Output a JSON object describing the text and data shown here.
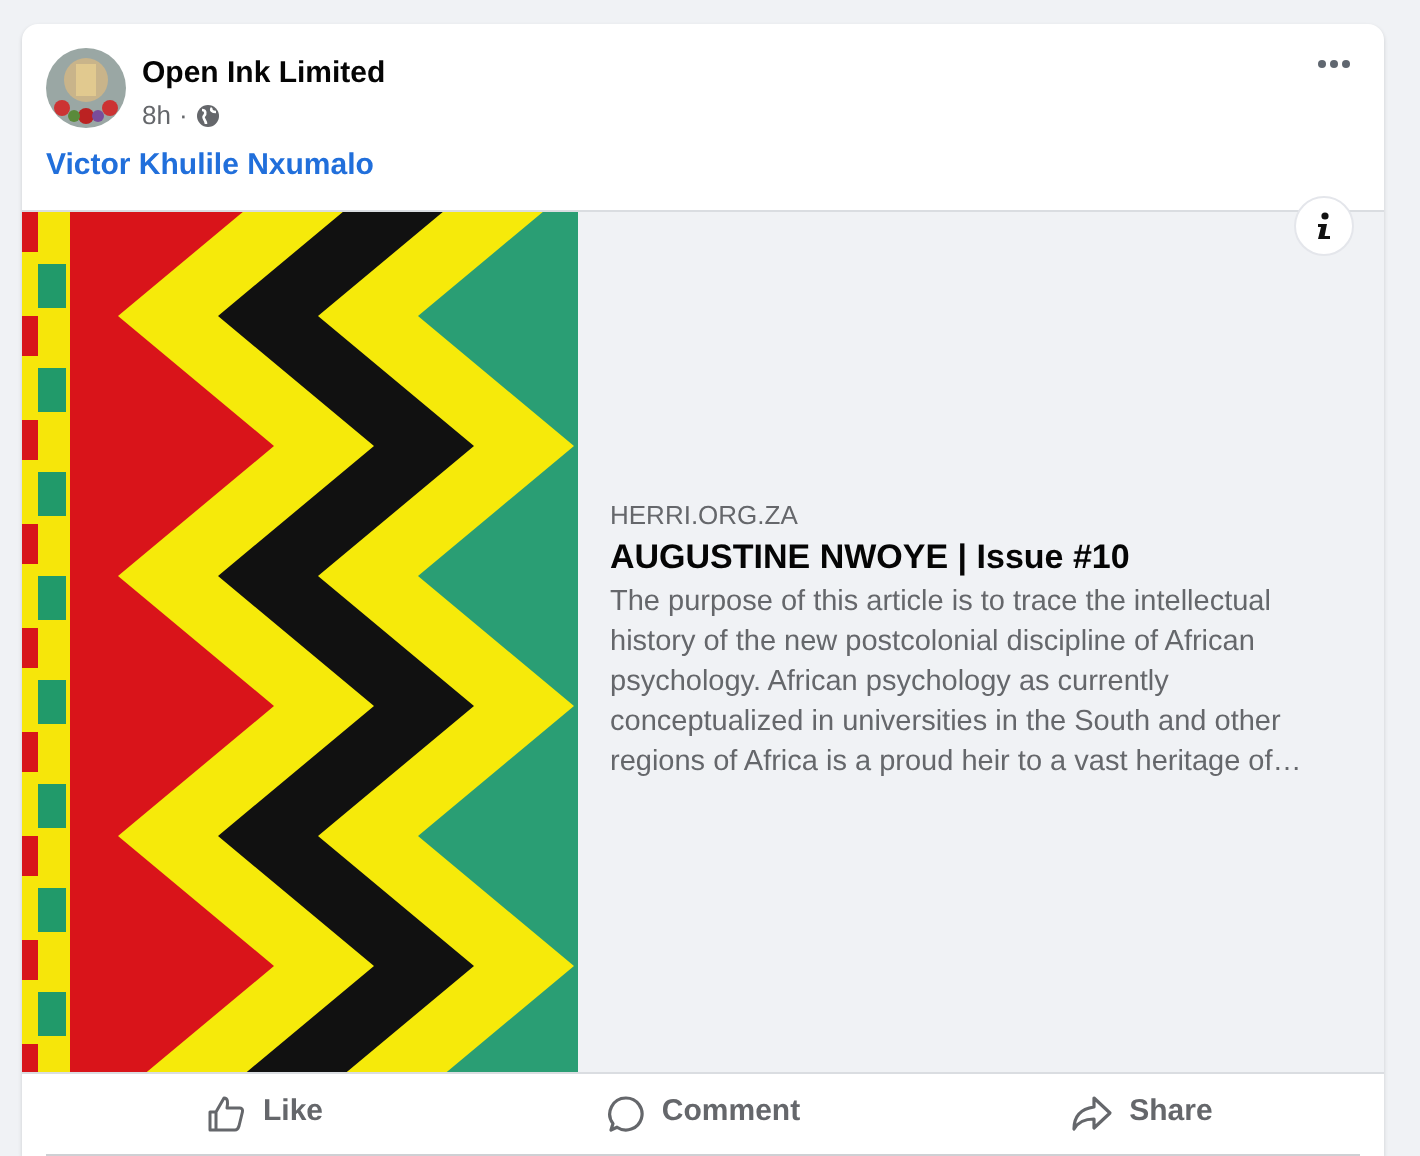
{
  "post": {
    "author": "Open Ink Limited",
    "time": "8h",
    "separator": "·",
    "tagged_link": "Victor Khulile Nxumalo"
  },
  "link_preview": {
    "domain": "HERRI.ORG.ZA",
    "title": "AUGUSTINE NWOYE | Issue #10",
    "description": "The purpose of this article is to trace the intellectual history of the new postcolonial discipline of African psychology. African psychology as currently conceptualized in universities in the South and other regions of Africa is a proud heir to a vast heritage of…"
  },
  "actions": [
    {
      "kind": "like",
      "label": "Like"
    },
    {
      "kind": "comment",
      "label": "Comment"
    },
    {
      "kind": "share",
      "label": "Share"
    }
  ]
}
